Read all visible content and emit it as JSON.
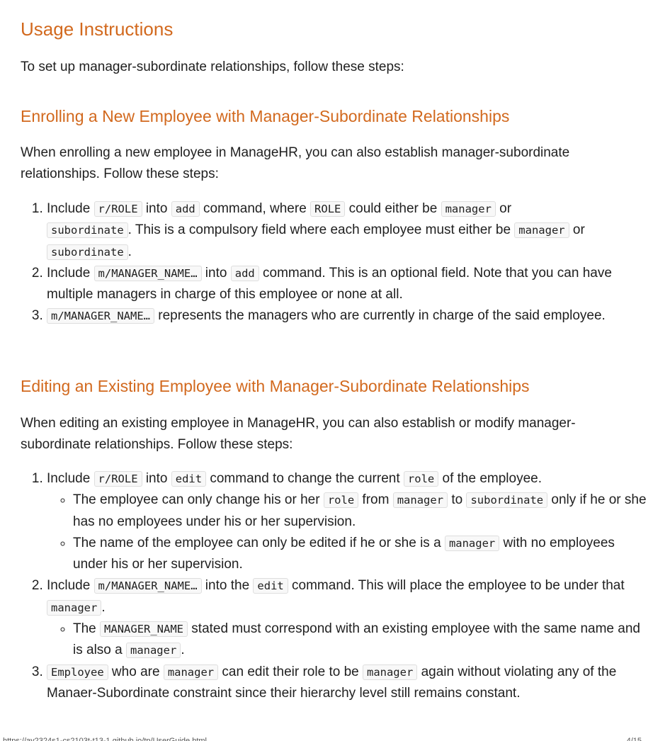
{
  "heading": "Usage Instructions",
  "intro": "To set up manager-subordinate relationships, follow these steps:",
  "section1": {
    "title": "Enrolling a New Employee with Manager-Subordinate Relationships",
    "intro": "When enrolling a new employee in ManageHR, you can also establish manager-subordinate relationships. Follow these steps:",
    "s1": {
      "t1": "Include ",
      "c1": "r/ROLE",
      "t2": " into ",
      "c2": "add",
      "t3": " command, where ",
      "c3": "ROLE",
      "t4": " could either be ",
      "c4": "manager",
      "t5": " or ",
      "c5": "subordinate",
      "t6": ". This is a compulsory field where each employee must either be ",
      "c6": "manager",
      "t7": " or ",
      "c7": "subordinate",
      "t8": "."
    },
    "s2": {
      "t1": "Include ",
      "c1": "m/MANAGER_NAME…",
      "t2": " into ",
      "c2": "add",
      "t3": " command. This is an optional field. Note that you can have multiple managers in charge of this employee or none at all."
    },
    "s3": {
      "c1": "m/MANAGER_NAME…",
      "t1": " represents the managers who are currently in charge of the said employee."
    }
  },
  "section2": {
    "title": "Editing an Existing Employee with Manager-Subordinate Relationships",
    "intro": "When editing an existing employee in ManageHR, you can also establish or modify manager-subordinate relationships. Follow these steps:",
    "s1": {
      "t1": "Include ",
      "c1": "r/ROLE",
      "t2": " into ",
      "c2": "edit",
      "t3": " command to change the current ",
      "c3": "role",
      "t4": " of the employee.",
      "b1": {
        "t1": "The employee can only change his or her ",
        "c1": "role",
        "t2": " from ",
        "c2": "manager",
        "t3": " to ",
        "c3": "subordinate",
        "t4": " only if he or she has no employees under his or her supervision."
      },
      "b2": {
        "t1": "The name of the employee can only be edited if he or she is a ",
        "c1": "manager",
        "t2": " with no employees under his or her supervision."
      }
    },
    "s2": {
      "t1": "Include ",
      "c1": "m/MANAGER_NAME…",
      "t2": " into the ",
      "c2": "edit",
      "t3": " command. This will place the employee to be under that ",
      "c3": "manager",
      "t4": ".",
      "b1": {
        "t1": "The ",
        "c1": "MANAGER_NAME",
        "t2": " stated must correspond with an existing employee with the same name and is also a ",
        "c2": "manager",
        "t3": "."
      }
    },
    "s3": {
      "c1": "Employee",
      "t1": " who are ",
      "c2": "manager",
      "t2": " can edit their role to be ",
      "c3": "manager",
      "t3": " again without violating any of the Manaer-Subordinate constraint since their hierarchy level still remains constant."
    }
  },
  "footer": {
    "url": "https://ay2324s1-cs2103t-t13-1.github.io/tp/UserGuide.html",
    "page": "4/15"
  }
}
